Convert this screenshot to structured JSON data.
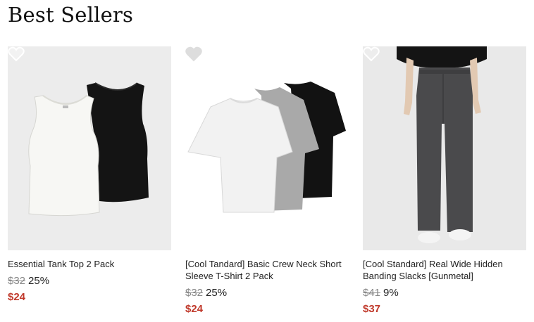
{
  "section": {
    "title": "Best Sellers"
  },
  "products": [
    {
      "name": "Essential Tank Top 2 Pack",
      "original_price": "$32",
      "discount": "25%",
      "sale_price": "$24",
      "wishlist_icon": "heart-outline-icon"
    },
    {
      "name": "[Cool Tandard] Basic Crew Neck Short Sleeve T-Shirt 2 Pack",
      "original_price": "$32",
      "discount": "25%",
      "sale_price": "$24",
      "wishlist_icon": "heart-outline-icon"
    },
    {
      "name": "[Cool Standard] Real Wide Hidden Banding Slacks [Gunmetal]",
      "original_price": "$41",
      "discount": "9%",
      "sale_price": "$37",
      "wishlist_icon": "heart-outline-icon"
    }
  ],
  "colors": {
    "sale": "#c0392b",
    "strike": "#888888"
  }
}
